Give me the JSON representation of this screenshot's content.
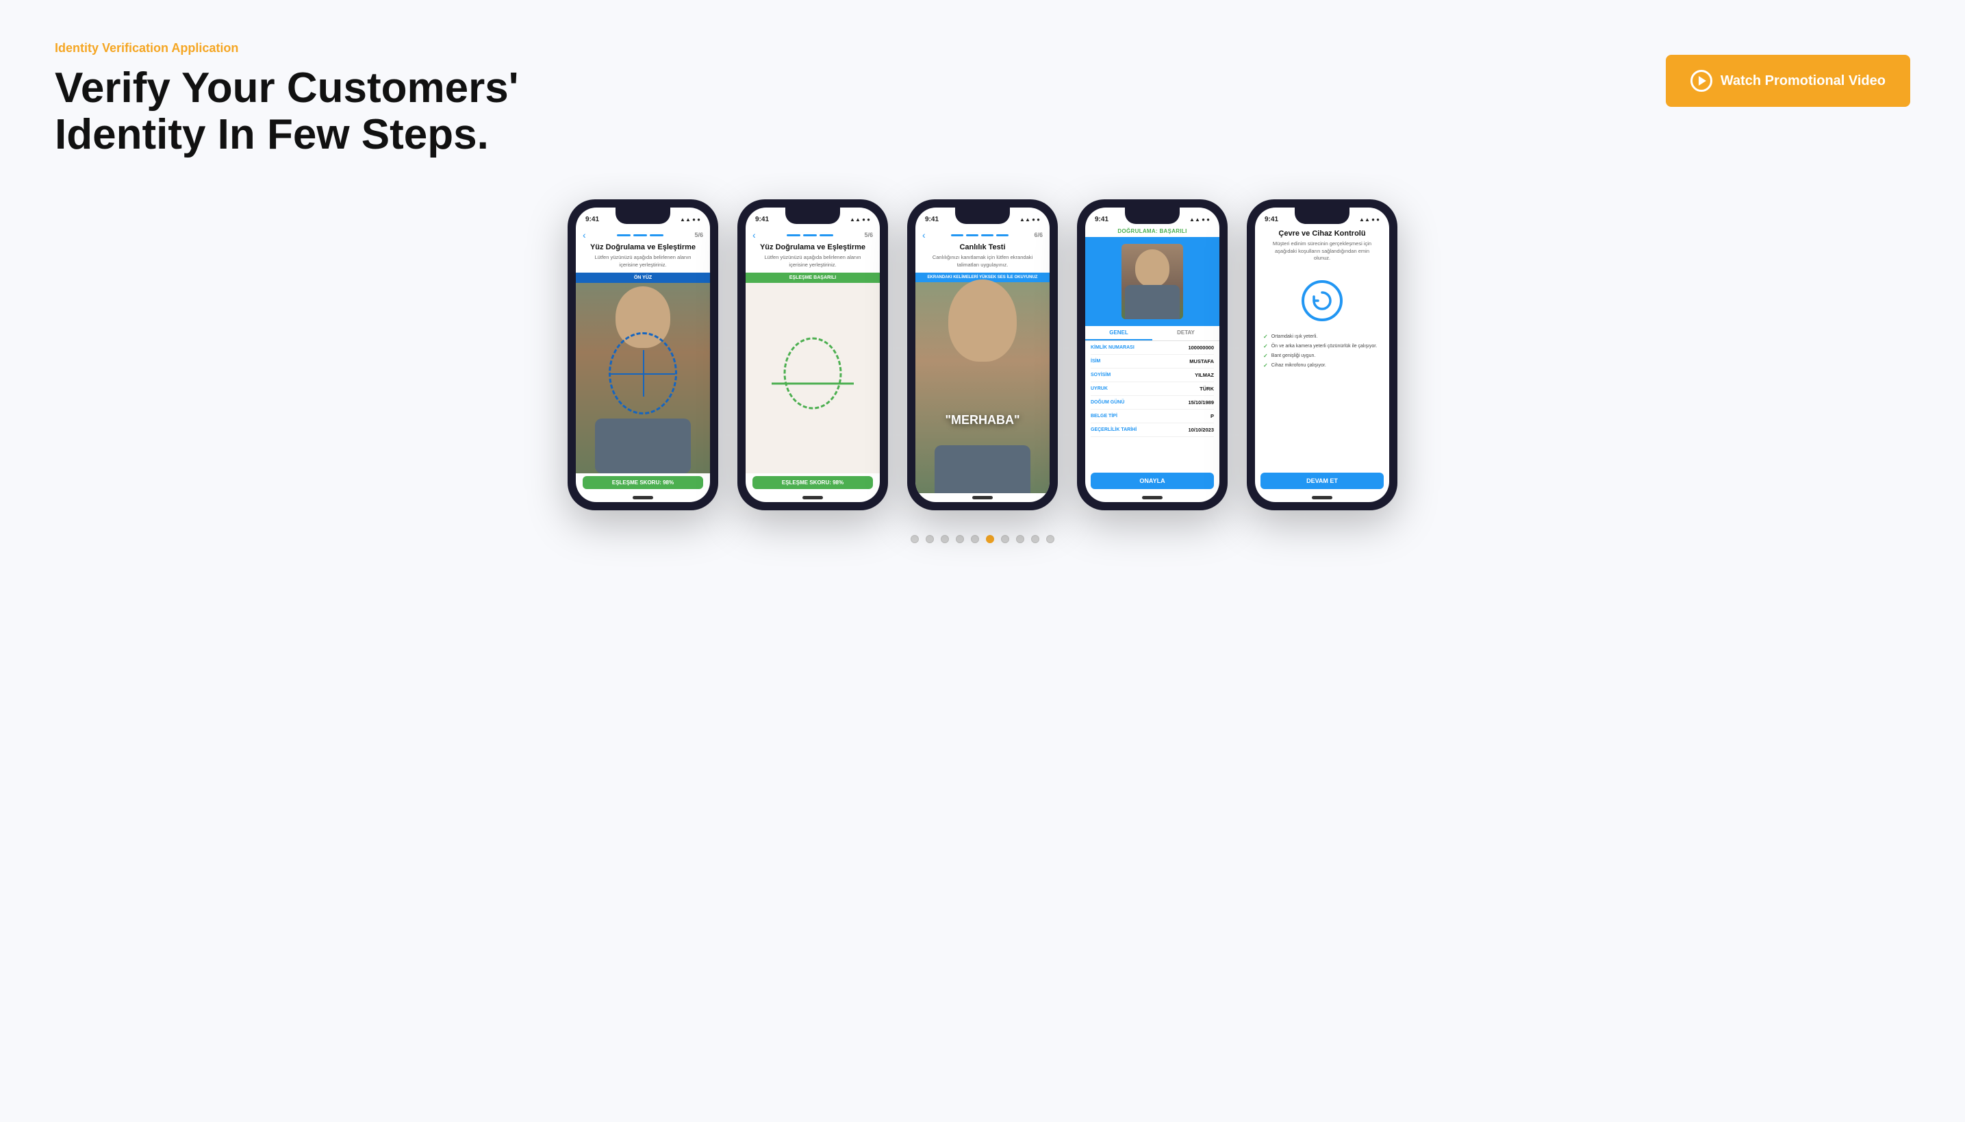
{
  "header": {
    "subtitle": "Identity Verification Application",
    "main_title_line1": "Verify Your Customers'",
    "main_title_line2": "Identity In Few Steps.",
    "watch_button": "Watch Promotional Video"
  },
  "phones": [
    {
      "id": "phone1",
      "status_time": "9:41",
      "screen_title": "Yüz Doğrulama ve Eşleştirme",
      "screen_subtitle": "Lütfen yüzünüzü aşağıda belirlenen alanın içerisine yerleştiriniz.",
      "nav_counter": "5/6",
      "camera_banner": "ÖN YÜZ",
      "camera_banner_type": "blue",
      "score_text": "EŞLEŞME SKORU: 98%",
      "face_type": "blue_circle"
    },
    {
      "id": "phone2",
      "status_time": "9:41",
      "screen_title": "Yüz Doğrulama ve Eşleştirme",
      "screen_subtitle": "Lütfen yüzünüzü aşağıda belirlenen alanın içerisine yerleştiriniz.",
      "nav_counter": "5/6",
      "camera_banner": "EŞLEŞME BAŞARILI",
      "camera_banner_type": "green",
      "score_text": "EŞLEŞME SKORU: 98%",
      "face_type": "green_circle"
    },
    {
      "id": "phone3",
      "status_time": "9:41",
      "screen_title": "Canlılık Testi",
      "screen_subtitle": "Canlılığınızı kanıtlamak için lütfen ekrandaki talimatları uygulayınız.",
      "nav_counter": "6/6",
      "camera_banner": "EKRANDAKI KELİMELERİ YÜKSEK SES İLE OKUYUNUZ",
      "camera_banner_type": "blue_light",
      "merhaba": "\"MERHABA\"",
      "face_type": "none"
    },
    {
      "id": "phone4",
      "status_time": "9:41",
      "success_label": "DOĞRULAMA: BAŞARILI",
      "tabs": [
        "GENEL",
        "DETAY"
      ],
      "active_tab": "GENEL",
      "info_rows": [
        {
          "label": "KİMLİK NUMARASI",
          "value": "100000000"
        },
        {
          "label": "İSİM",
          "value": "MUSTAFA"
        },
        {
          "label": "SOYİSİM",
          "value": "YILMAZ"
        },
        {
          "label": "UYRUK",
          "value": "TÜRK"
        },
        {
          "label": "DOĞUM GÜNÜ",
          "value": "15/10/1989"
        },
        {
          "label": "BELGE TİPİ",
          "value": "P"
        },
        {
          "label": "GEÇERLİLİK TARİHİ",
          "value": "10/10/2023"
        }
      ],
      "approve_btn": "ONAYLA"
    },
    {
      "id": "phone5",
      "status_time": "9:41",
      "screen_title": "Çevre ve Cihaz Kontrolü",
      "screen_subtitle": "Müşteri edinim sürecinin gerçekleşmesi için aşağıdaki koşulların sağlandığından emin olunuz.",
      "check_items": [
        "Ortamdaki ışık yeterli.",
        "Ön ve arka kamera yeterli çözünürlük ile çalışıyor.",
        "Bant genişliği uygun.",
        "Cihaz mikrofonu çalışıyor."
      ],
      "continue_btn": "DEVAM ET"
    }
  ],
  "dots": {
    "count": 10,
    "active_index": 6
  },
  "colors": {
    "orange": "#f5a623",
    "blue": "#2196f3",
    "green": "#4caf50",
    "dark_blue": "#1565c0"
  }
}
